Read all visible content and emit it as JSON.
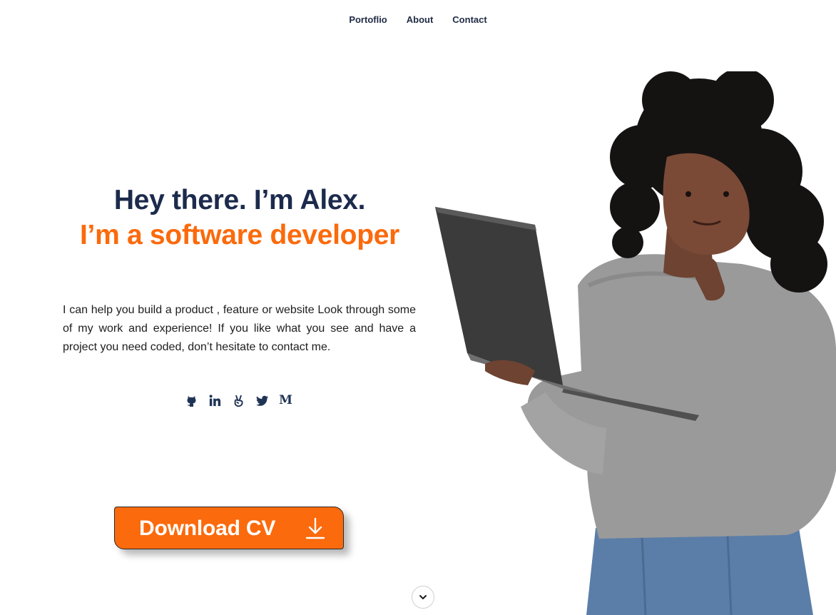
{
  "nav": {
    "items": [
      {
        "label": "Portoflio"
      },
      {
        "label": "About"
      },
      {
        "label": "Contact"
      }
    ]
  },
  "hero": {
    "title": "Hey there. I’m Alex.",
    "subtitle": "I’m a software developer",
    "description": "I can help you build a product , feature or website Look through some of my work and experience! If you like what you see and have a project you need coded, don’t hesitate to contact me."
  },
  "social": {
    "icons": [
      "github-icon",
      "linkedin-icon",
      "angellist-icon",
      "twitter-icon",
      "medium-icon"
    ],
    "medium_glyph": "M"
  },
  "cta": {
    "label": "Download CV",
    "icon": "download-icon"
  },
  "scroll": {
    "icon": "chevron-down-icon"
  },
  "colors": {
    "accent": "#fb6a0c",
    "heading": "#1c2b4c",
    "icon": "#1f3356",
    "background": "#ffffff"
  }
}
